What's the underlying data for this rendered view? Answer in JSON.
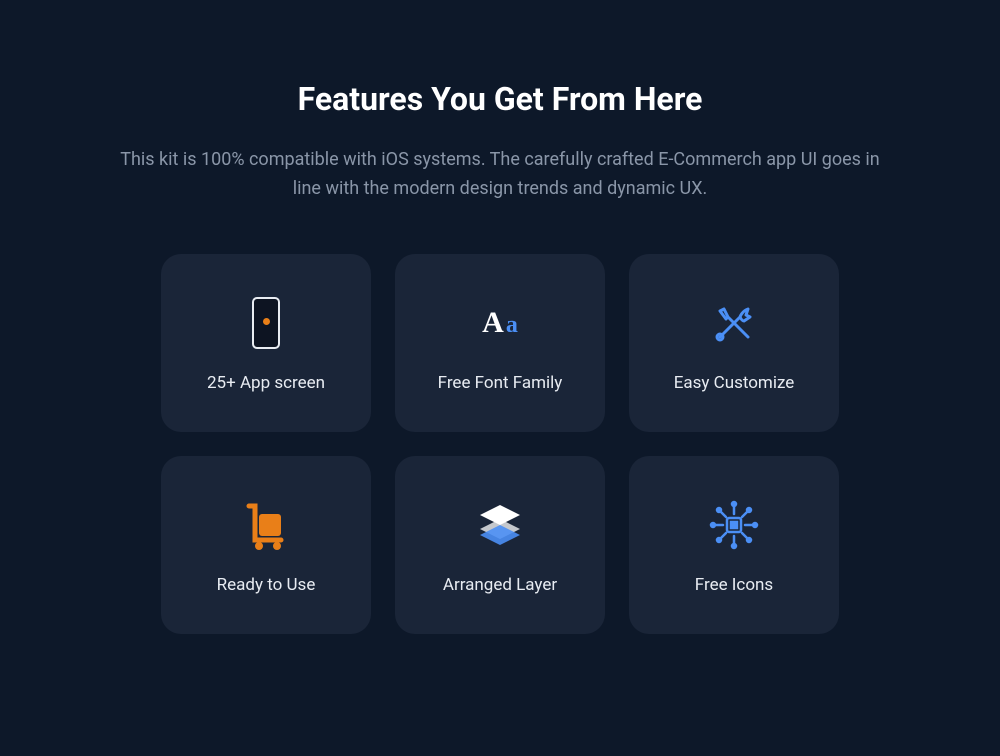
{
  "header": {
    "title": "Features You Get From Here",
    "subtitle": "This kit is 100% compatible with iOS systems. The carefully crafted E-Commerch app UI goes in line with the modern design trends and dynamic UX."
  },
  "features": [
    {
      "label": "25+ App screen",
      "icon": "phone-icon"
    },
    {
      "label": "Free Font Family",
      "icon": "font-icon"
    },
    {
      "label": "Easy Customize",
      "icon": "tools-icon"
    },
    {
      "label": "Ready to Use",
      "icon": "cart-icon"
    },
    {
      "label": "Arranged Layer",
      "icon": "layers-icon"
    },
    {
      "label": "Free Icons",
      "icon": "cpu-icon"
    }
  ],
  "colors": {
    "bg": "#0d1829",
    "card": "#1a2538",
    "text": "#ffffff",
    "muted": "#8a96a8",
    "accent_blue": "#4b8ff5",
    "accent_orange": "#e97f18"
  }
}
